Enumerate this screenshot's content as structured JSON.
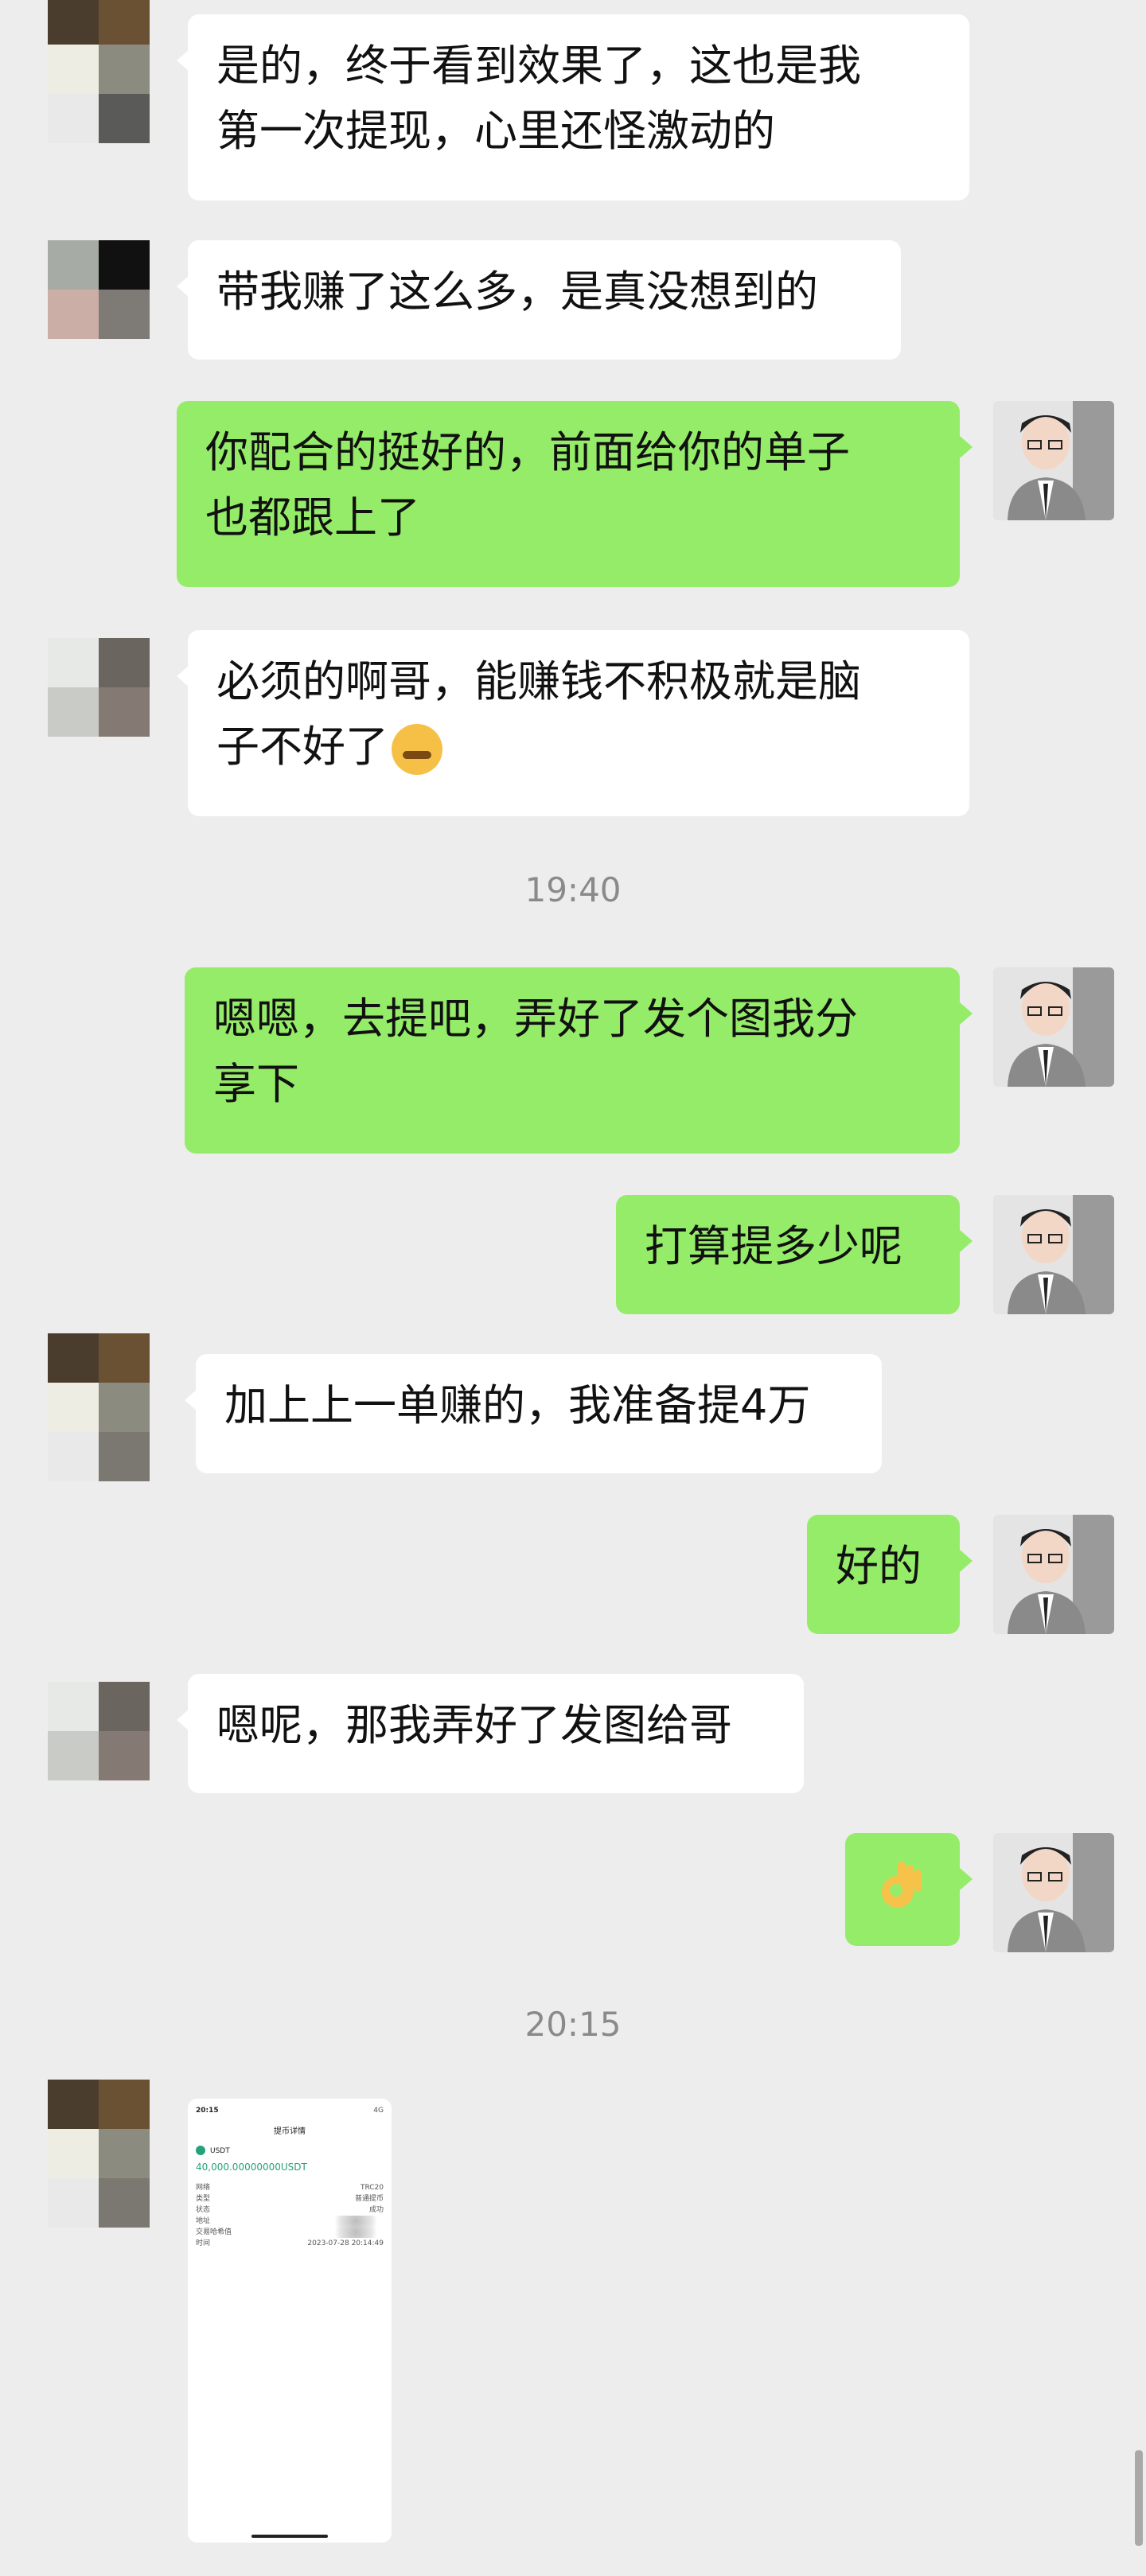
{
  "messages": [
    {
      "side": "left",
      "text_a": "是的，终于看到效果了，这也是我",
      "text_b": "第一次提现，心里还怪激动的"
    },
    {
      "side": "left",
      "text": "带我赚了这么多，是真没想到的"
    },
    {
      "side": "right",
      "text_a": "你配合的挺好的，前面给你的单子",
      "text_b": "也都跟上了"
    },
    {
      "side": "left",
      "text_a": "必须的啊哥，能赚钱不积极就是脑",
      "text_b": "子不好了"
    },
    {
      "side": "right",
      "text_a": "嗯嗯，去提吧，弄好了发个图我分",
      "text_b": "享下"
    },
    {
      "side": "right",
      "text": "打算提多少呢"
    },
    {
      "side": "left",
      "text": "加上上一单赚的，我准备提4万"
    },
    {
      "side": "right",
      "text": "好的"
    },
    {
      "side": "left",
      "text": "嗯呢，那我弄好了发图给哥"
    },
    {
      "side": "right",
      "emoji": "ok-hand"
    }
  ],
  "timestamps": [
    "19:40",
    "20:15"
  ],
  "screenshot": {
    "status_time": "20:15",
    "status_right": "4G",
    "title": "提币详情",
    "coin": "USDT",
    "amount": "40,000.00000000USDT",
    "rows": [
      {
        "label": "网络",
        "value": "TRC20"
      },
      {
        "label": "类型",
        "value": "普通提币"
      },
      {
        "label": "状态",
        "value": "成功"
      },
      {
        "label": "地址",
        "value": ""
      },
      {
        "label": "交易哈希值",
        "value": ""
      },
      {
        "label": "时间",
        "value": "2023-07-28 20:14:49"
      }
    ]
  },
  "colors": {
    "green_bubble": "#95ec69",
    "background": "#ededed",
    "white_bubble": "#ffffff"
  }
}
